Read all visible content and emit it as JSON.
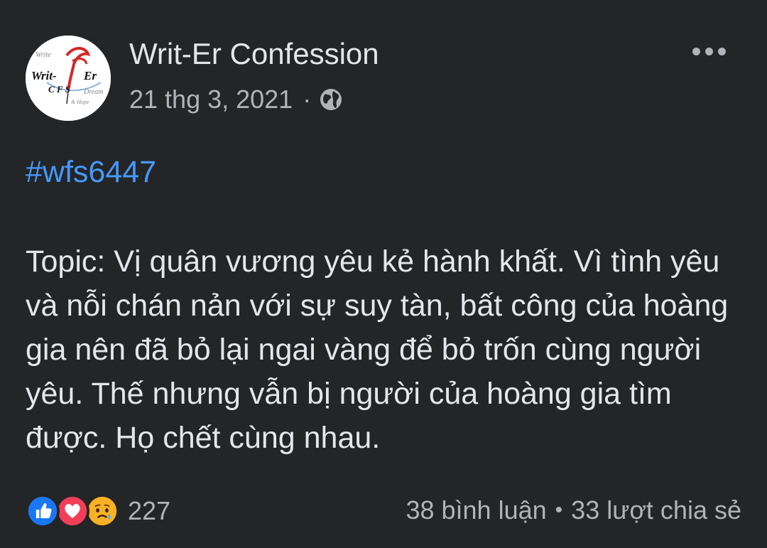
{
  "post": {
    "page_name": "Writ-Er Confession",
    "date": "21 thg 3, 2021",
    "meta_separator": "·",
    "privacy_icon": "globe-icon",
    "more_icon": "more-options-icon",
    "hashtag": "#wfs6447",
    "body": "Topic: Vị quân vương yêu kẻ hành khất. Vì tình yêu và nỗi chán nản với sự suy tàn, bất công của hoàng gia nên đã bỏ lại ngai vàng để bỏ trốn cùng người yêu. Thế nhưng vẫn bị người của hoàng gia tìm được. Họ chết cùng nhau."
  },
  "avatar": {
    "logo_text_top": "Write",
    "logo_text_main_left": "Writ-",
    "logo_text_main_right": "Er",
    "logo_text_cfs": "C F S",
    "logo_text_dream": "Dream",
    "logo_text_hope": "& Hope"
  },
  "reactions": {
    "icons": [
      "like-reaction-icon",
      "love-reaction-icon",
      "sad-reaction-icon"
    ],
    "count": "227"
  },
  "stats": {
    "comments": "38 bình luận",
    "separator": "•",
    "shares": "33 lượt chia sẻ"
  },
  "colors": {
    "background": "#242526",
    "primary_text": "#e4e6eb",
    "secondary_text": "#b0b3b8",
    "hashtag": "#4599ff",
    "like": "#1877f2",
    "love": "#f33e58",
    "sad": "#f7b125"
  }
}
